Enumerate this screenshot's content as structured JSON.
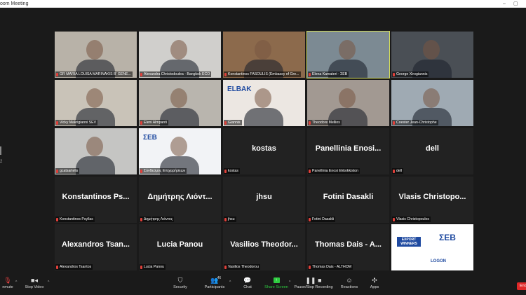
{
  "window": {
    "title": "oom Meeting",
    "controls": [
      "–",
      "▢"
    ]
  },
  "side_glyph": "2",
  "tiles": [
    {
      "label": "GR MARIA LOUISA MARINAKIS B' GENE...",
      "kind": "video",
      "bg": "#b8b2a8"
    },
    {
      "label": "Alexandra Christodoulea - Bangkok ECO",
      "kind": "video",
      "bg": "#d0cfcc"
    },
    {
      "label": "Konstantinos FASOULIS (Embassy of Gre...",
      "kind": "video",
      "bg": "#8c6a4c"
    },
    {
      "label": "Elena Kamateri - ΣΕΒ",
      "kind": "video",
      "bg": "#7c8a93",
      "active": true
    },
    {
      "label": "George Xirogiannis",
      "kind": "video",
      "bg": "#4a4f55"
    },
    {
      "label": "Vicky Makrigianni SEV",
      "kind": "video",
      "bg": "#c9c3b8"
    },
    {
      "label": "Eleni Almpanti",
      "kind": "video",
      "bg": "#b9b5ae"
    },
    {
      "label": "Giannis",
      "kind": "video",
      "bg": "#ece7e2",
      "logo": "ELBAK"
    },
    {
      "label": "Theodore Mellios",
      "kind": "video",
      "bg": "#a29992"
    },
    {
      "label": "Coester Jean-Christophe",
      "kind": "video",
      "bg": "#9faab3"
    },
    {
      "label": "gcatsartelis",
      "kind": "video",
      "bg": "#c5c5c3"
    },
    {
      "label": "Σύνδεσμος Επιχειρήσεων",
      "kind": "video",
      "bg": "#f2f3f6",
      "logo": "ΣΕΒ"
    },
    {
      "label": "kostas",
      "kind": "name",
      "display": "kostas"
    },
    {
      "label": "Panellinia Enosi Ekkokkiston",
      "kind": "name",
      "display": "Panellinia Enosi..."
    },
    {
      "label": "dell",
      "kind": "name",
      "display": "dell"
    },
    {
      "label": "Konstantinos Psyllas",
      "kind": "name",
      "display": "Konstantinos Ps..."
    },
    {
      "label": "Δημήτρης Λιόντος",
      "kind": "name",
      "display": "Δημήτρης Λιόντ..."
    },
    {
      "label": "jhsu",
      "kind": "name",
      "display": "jhsu"
    },
    {
      "label": "Fotini Dasakli",
      "kind": "name",
      "display": "Fotini Dasakli"
    },
    {
      "label": "Vlasis Christopoulos",
      "kind": "name",
      "display": "Vlasis Christopo..."
    },
    {
      "label": "Alexandros Tsantos",
      "kind": "name",
      "display": "Alexandros Tsan..."
    },
    {
      "label": "Lucia Panou",
      "kind": "name",
      "display": "Lucia Panou"
    },
    {
      "label": "Vasilios Theodorou",
      "kind": "name",
      "display": "Vasilios Theodor..."
    },
    {
      "label": "Thomas Dais - ALTHOM",
      "kind": "name",
      "display": "Thomas Dais - A..."
    },
    {
      "label": "",
      "kind": "share",
      "bg": "#ffffff",
      "texts": {
        "a": "EXPORT WINNERS",
        "b": "ΣΕΒ",
        "c": "LOGON"
      }
    }
  ],
  "toolbar": {
    "mute": {
      "label": "nmute",
      "icon": "microphone-off-icon"
    },
    "video": {
      "label": "Stop Video",
      "icon": "camera-icon"
    },
    "security": {
      "label": "Security",
      "icon": "shield-icon"
    },
    "participants": {
      "label": "Participants",
      "count": "46",
      "icon": "people-icon"
    },
    "chat": {
      "label": "Chat",
      "icon": "chat-icon"
    },
    "share": {
      "label": "Share Screen",
      "icon": "share-screen-icon",
      "color": "#2ecc40"
    },
    "record": {
      "label": "Pause/Stop Recording",
      "icon": "pause-icon"
    },
    "reactions": {
      "label": "Reactions",
      "icon": "emoji-icon"
    },
    "apps": {
      "label": "Apps",
      "icon": "apps-icon"
    },
    "end": {
      "label": "End",
      "color": "#e02828"
    }
  }
}
